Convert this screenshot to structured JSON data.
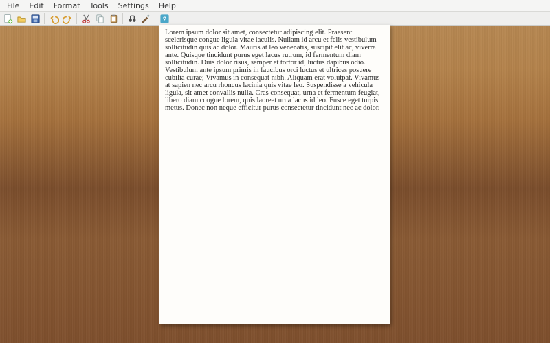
{
  "menubar": {
    "items": [
      "File",
      "Edit",
      "Format",
      "Tools",
      "Settings",
      "Help"
    ]
  },
  "toolbar": {
    "icons": [
      "new-icon",
      "open-icon",
      "save-icon",
      "sep",
      "undo-icon",
      "redo-icon",
      "sep",
      "cut-icon",
      "copy-icon",
      "paste-icon",
      "sep",
      "find-icon",
      "config-icon",
      "sep",
      "help-icon"
    ]
  },
  "document": {
    "paragraph": "Lorem ipsum dolor sit amet, consectetur adipiscing elit. Praesent scelerisque congue ligula vitae iaculis. Nullam id arcu et felis vestibulum sollicitudin quis ac dolor. Mauris at leo venenatis, suscipit elit ac, viverra ante. Quisque tincidunt purus eget lacus rutrum, id fermentum diam sollicitudin. Duis dolor risus, semper et tortor id, luctus dapibus odio. Vestibulum ante ipsum primis in faucibus orci luctus et ultrices posuere cubilia curae; Vivamus in consequat nibh. Aliquam erat volutpat. Vivamus at sapien nec arcu rhoncus lacinia quis vitae leo. Suspendisse a vehicula ligula, sit amet convallis nulla. Cras consequat, urna et fermentum feugiat, libero diam congue lorem, quis laoreet urna lacus id leo. Fusce eget turpis metus. Donec non neque efficitur purus consectetur tincidunt nec ac dolor."
  }
}
